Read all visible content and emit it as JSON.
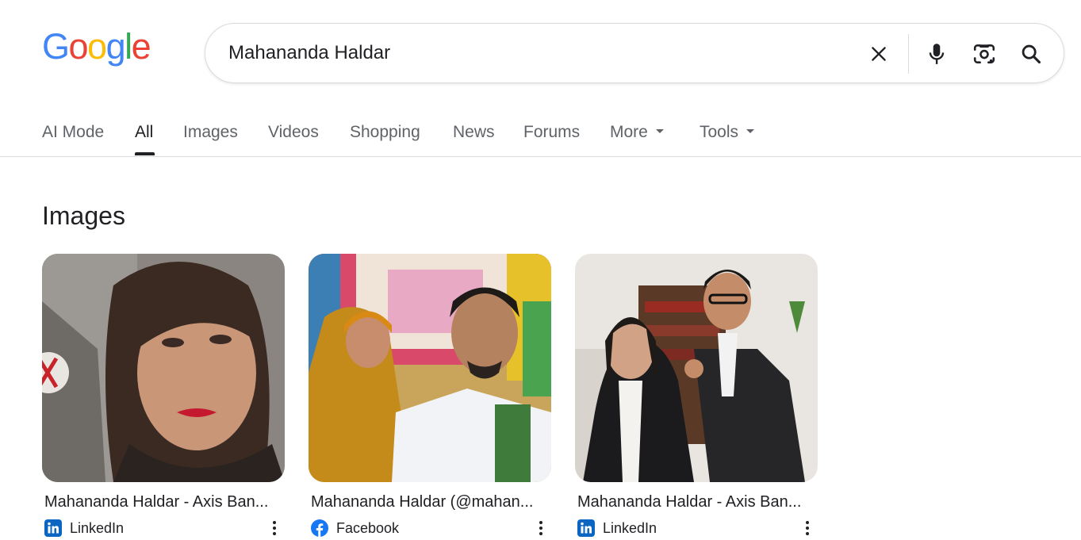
{
  "logo": {
    "letters": [
      "G",
      "o",
      "o",
      "g",
      "l",
      "e"
    ],
    "colors": [
      "#4285F4",
      "#EA4335",
      "#FBBC05",
      "#4285F4",
      "#34A853",
      "#EA4335"
    ]
  },
  "search": {
    "value": "Mahananda Haldar",
    "icons": [
      "close-icon",
      "microphone-icon",
      "lens-camera-icon",
      "search-icon"
    ]
  },
  "tabs": [
    {
      "label": "AI Mode"
    },
    {
      "label": "All",
      "active": true
    },
    {
      "label": "Images"
    },
    {
      "label": "Videos"
    },
    {
      "label": "Shopping"
    },
    {
      "label": "News"
    },
    {
      "label": "Forums"
    },
    {
      "label": "More",
      "dropdown": true
    },
    {
      "label": "Tools",
      "dropdown": true
    }
  ],
  "images_section": {
    "title": "Images",
    "results": [
      {
        "title": "Mahananda Haldar - Axis Ban...",
        "source": "LinkedIn",
        "source_icon": "linkedin-icon"
      },
      {
        "title": "Mahananda Haldar (@mahan...",
        "source": "Facebook",
        "source_icon": "facebook-icon"
      },
      {
        "title": "Mahananda Haldar - Axis Ban...",
        "source": "LinkedIn",
        "source_icon": "linkedin-icon"
      }
    ]
  },
  "colors": {
    "text": "#202124",
    "muted": "#5f6368",
    "border": "#dadce0",
    "linkedin": "#0A66C2",
    "facebook": "#1877F2"
  }
}
